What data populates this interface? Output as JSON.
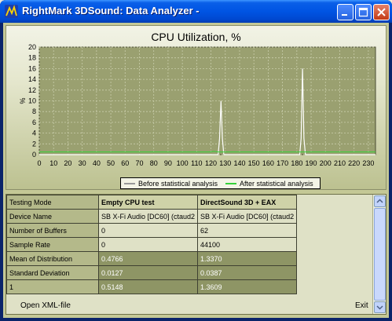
{
  "window": {
    "title": "RightMark 3DSound: Data Analyzer -",
    "buttons": {
      "minimize": "minimize",
      "maximize": "maximize",
      "close": "close"
    }
  },
  "chart_data": {
    "type": "line",
    "title": "CPU Utilization, %",
    "xlabel": "",
    "ylabel": "%",
    "xlim": [
      0,
      235
    ],
    "ylim": [
      0,
      20
    ],
    "x_ticks": [
      0,
      10,
      20,
      30,
      40,
      50,
      60,
      70,
      80,
      90,
      100,
      110,
      120,
      130,
      140,
      150,
      160,
      170,
      180,
      190,
      200,
      210,
      220,
      230
    ],
    "y_ticks": [
      0,
      2,
      4,
      6,
      8,
      10,
      12,
      14,
      16,
      18,
      20
    ],
    "grid": true,
    "legend_position": "bottom-center",
    "series": [
      {
        "name": "Before statistical analysis",
        "color": "#ffffff",
        "x": [
          0,
          119,
          123,
          125,
          126,
          127,
          128,
          129,
          130,
          180,
          182,
          183,
          184,
          185,
          186,
          187,
          188,
          235
        ],
        "y": [
          0,
          0,
          0,
          0,
          3,
          10,
          3,
          0,
          0,
          0,
          0,
          3,
          16,
          3,
          0,
          0,
          0,
          0
        ]
      },
      {
        "name": "After statistical analysis",
        "color": "#36d23a",
        "x": [
          0,
          119,
          122,
          125,
          130,
          180,
          235
        ],
        "y": [
          0.5,
          0.5,
          0.6,
          0.5,
          0.5,
          0.5,
          0.5
        ]
      }
    ]
  },
  "table": {
    "column_headers": [
      "Testing Mode",
      "Empty CPU test",
      "DirectSound 3D + EAX"
    ],
    "rows": [
      [
        "Device Name",
        "SB X-Fi Audio [DC60] (ctaud2",
        "SB X-Fi Audio [DC60] (ctaud2"
      ],
      [
        "Number of Buffers",
        "0",
        "62"
      ],
      [
        "Sample Rate",
        "0",
        "44100"
      ],
      [
        "Mean of Distribution",
        "0.4766",
        "1.3370"
      ],
      [
        "Standard Deviation",
        "0.0127",
        "0.0387"
      ],
      [
        "1",
        "0.5148",
        "1.3609"
      ]
    ]
  },
  "footer": {
    "open_xml": "Open XML-file",
    "exit": "Exit"
  },
  "colors": {
    "titlebar": "#0054e3",
    "plot_background": "#9aa070",
    "before_series": "#ffffff",
    "after_series": "#36d23a"
  }
}
